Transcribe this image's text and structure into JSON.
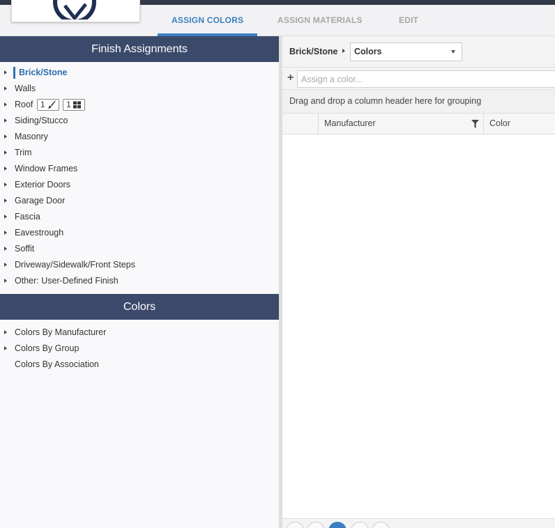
{
  "tabs": [
    {
      "label": "ASSIGN COLORS",
      "active": true
    },
    {
      "label": "ASSIGN MATERIALS",
      "active": false
    },
    {
      "label": "EDIT",
      "active": false
    }
  ],
  "finish_assignments": {
    "title": "Finish Assignments",
    "items": [
      {
        "label": "Brick/Stone",
        "selected": true
      },
      {
        "label": "Walls"
      },
      {
        "label": "Roof",
        "badges": [
          {
            "count": "1",
            "icon": "paintbrush-icon"
          },
          {
            "count": "1",
            "icon": "grid-icon"
          }
        ]
      },
      {
        "label": "Siding/Stucco"
      },
      {
        "label": "Masonry"
      },
      {
        "label": "Trim"
      },
      {
        "label": "Window Frames"
      },
      {
        "label": "Exterior Doors"
      },
      {
        "label": "Garage Door"
      },
      {
        "label": "Fascia"
      },
      {
        "label": "Eavestrough"
      },
      {
        "label": "Soffit"
      },
      {
        "label": "Driveway/Sidewalk/Front Steps"
      },
      {
        "label": "Other: User-Defined Finish"
      }
    ]
  },
  "colors_section": {
    "title": "Colors",
    "items": [
      {
        "label": "Colors By Manufacturer",
        "expandable": true
      },
      {
        "label": "Colors By Group",
        "expandable": true
      },
      {
        "label": "Colors By Association",
        "expandable": false
      }
    ]
  },
  "right_panel": {
    "breadcrumb": "Brick/Stone",
    "select_value": "Colors",
    "assign_placeholder": "Assign a color...",
    "group_hint": "Drag and drop a column header here for grouping",
    "columns": [
      "Manufacturer",
      "Color"
    ]
  },
  "colors": {
    "header_bg": "#3b4a6b",
    "accent": "#3b7fc0",
    "top_strip": "#333a49"
  }
}
